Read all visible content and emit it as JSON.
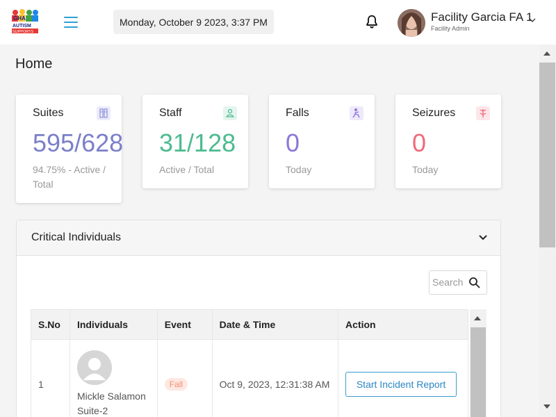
{
  "header": {
    "logo_text": "AUTISM SUPPORTS",
    "datetime": "Monday, October 9 2023, 3:37 PM",
    "user_name": "Facility Garcia FA 1",
    "user_role": "Facility Admin"
  },
  "page": {
    "title": "Home"
  },
  "cards": [
    {
      "title": "Suites",
      "value": "595/628",
      "sub": "94.75% - Active / Total",
      "color": "#7b7fc9",
      "icon": "suites-icon"
    },
    {
      "title": "Staff",
      "value": "31/128",
      "sub": "Active / Total",
      "color": "#4cbb8f",
      "icon": "staff-icon"
    },
    {
      "title": "Falls",
      "value": "0",
      "sub": "Today",
      "color": "#8d77d6",
      "icon": "falls-icon"
    },
    {
      "title": "Seizures",
      "value": "0",
      "sub": "Today",
      "color": "#f06b7c",
      "icon": "seizures-icon"
    }
  ],
  "critical": {
    "title": "Critical Individuals",
    "search_placeholder": "Search",
    "columns": [
      "S.No",
      "Individuals",
      "Event",
      "Date & Time",
      "Action"
    ],
    "rows": [
      {
        "sno": "1",
        "name": "Mickle Salamon",
        "suite": "Suite-2",
        "event": "Fall",
        "datetime": "Oct 9, 2023, 12:31:38 AM",
        "action": "Start Incident Report"
      }
    ]
  }
}
